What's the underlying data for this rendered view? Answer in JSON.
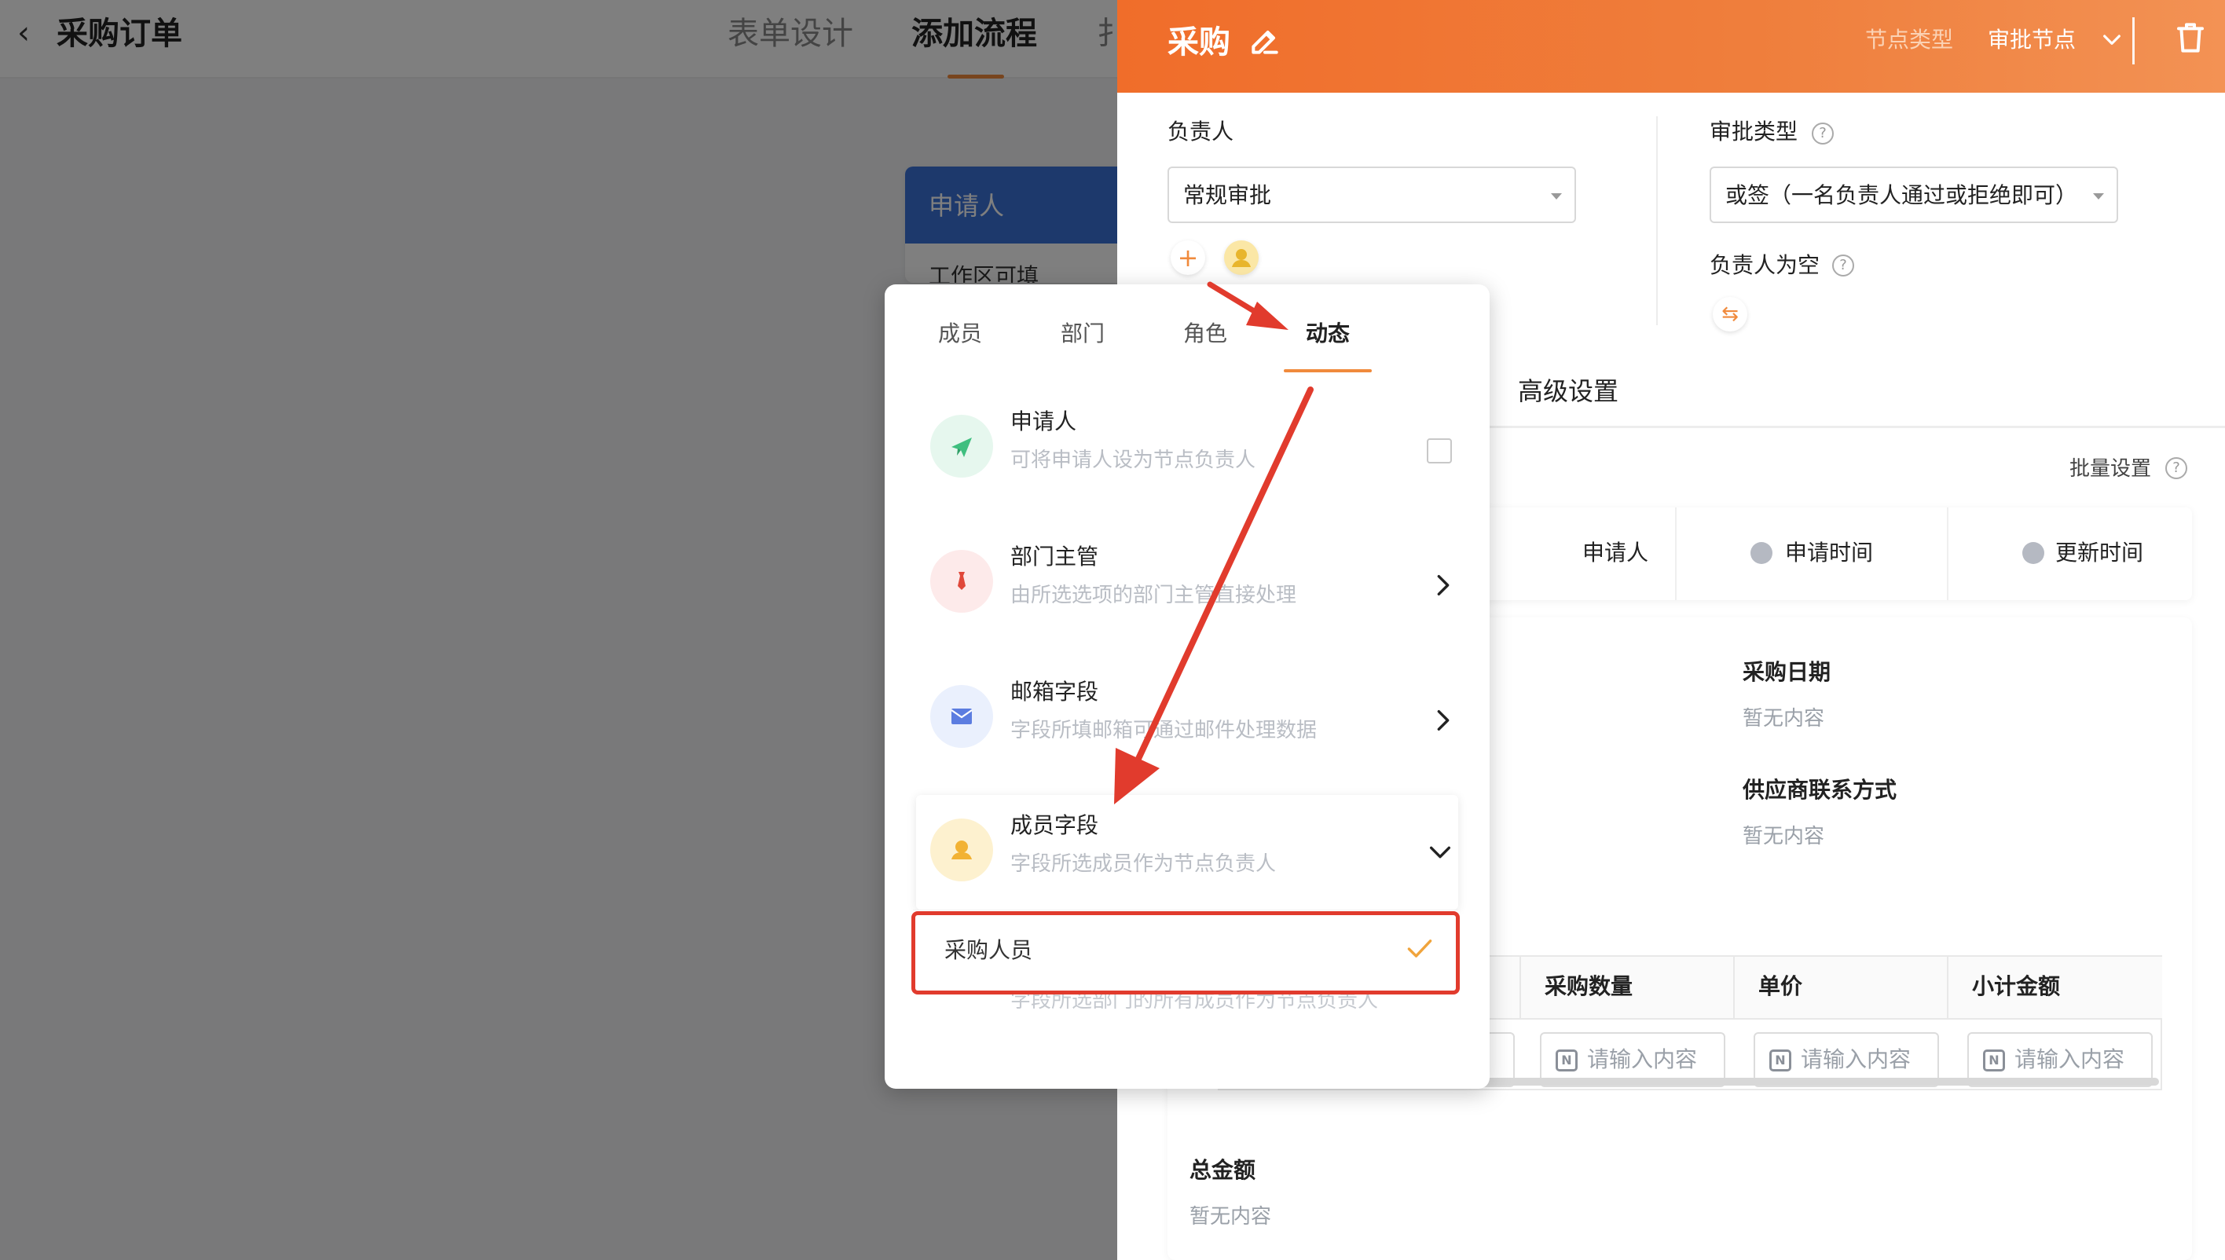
{
  "topbar": {
    "title": "采购订单",
    "tabs": [
      {
        "label": "表单设计"
      },
      {
        "label": "添加流程"
      },
      {
        "label": "扌"
      }
    ]
  },
  "flow_node": {
    "header": "申请人",
    "body": "工作区可填"
  },
  "panel": {
    "title": "采购",
    "node_type_label": "节点类型",
    "node_type_value": "审批节点",
    "owner_label": "负责人",
    "owner_select": "常规审批",
    "approval_type_label": "审批类型",
    "approval_type_value": "或签（一名负责人通过或拒绝即可）",
    "owner_empty_label": "负责人为空",
    "advanced_tab": "高级设置",
    "batch_label": "批量设置",
    "system_fields": [
      {
        "label": "申请人"
      },
      {
        "label": "申请时间"
      },
      {
        "label": "更新时间"
      }
    ],
    "fields": {
      "purchase_date_label": "采购日期",
      "purchase_date_value": "暂无内容",
      "supplier_contact_label": "供应商联系方式",
      "supplier_contact_value": "暂无内容",
      "total_label": "总金额",
      "total_value": "暂无内容"
    },
    "table": {
      "columns": [
        "采购数量",
        "单价",
        "小计金额"
      ],
      "placeholder": "请输入内容",
      "input_icon": "N"
    }
  },
  "popover": {
    "tabs": [
      "成员",
      "部门",
      "角色",
      "动态"
    ],
    "active_tab": "动态",
    "items": [
      {
        "title": "申请人",
        "desc": "可将申请人设为节点负责人",
        "icon": "send-icon",
        "color": "#3fbf7f"
      },
      {
        "title": "部门主管",
        "desc": "由所选选项的部门主管直接处理",
        "icon": "tie-icon",
        "color": "#e0483a"
      },
      {
        "title": "邮箱字段",
        "desc": "字段所填邮箱可通过邮件处理数据",
        "icon": "mail-icon",
        "color": "#5c7de0"
      },
      {
        "title": "成员字段",
        "desc": "字段所选成员作为节点负责人",
        "icon": "user-icon",
        "color": "#f2b233"
      }
    ],
    "sub_option": "采购人员",
    "dept_field_desc": "字段所选部门的所有成员作为节点负责人"
  },
  "colors": {
    "accent": "#f08a3c",
    "highlight": "#e13b2d"
  }
}
